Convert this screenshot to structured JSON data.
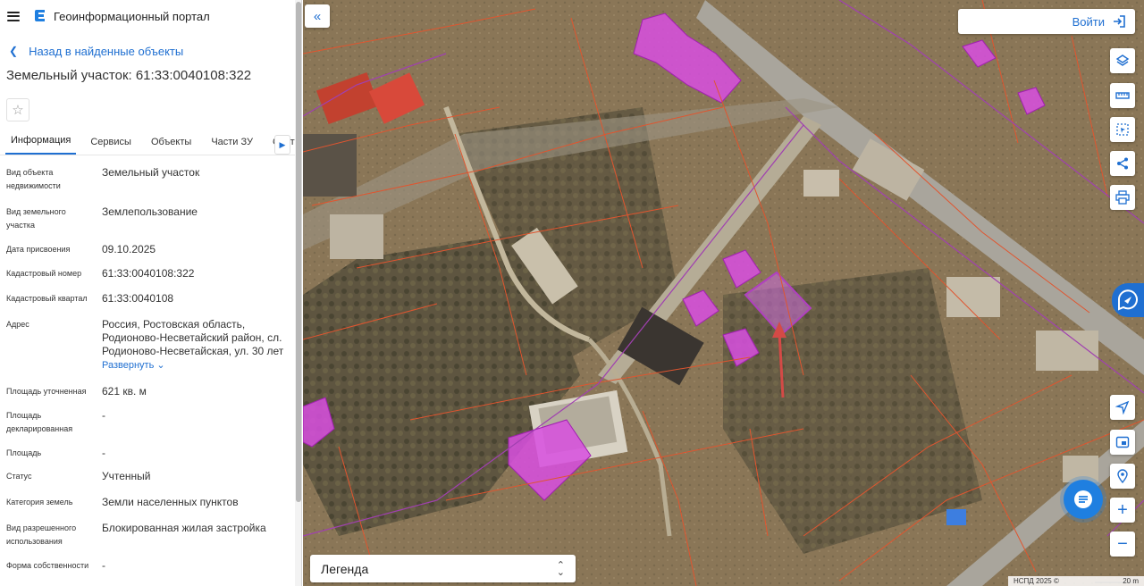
{
  "header": {
    "app_title": "Геоинформационный портал"
  },
  "back_link": "Назад в найденные объекты",
  "object_title": "Земельный участок: 61:33:0040108:322",
  "tabs": [
    {
      "label": "Информация"
    },
    {
      "label": "Сервисы"
    },
    {
      "label": "Объекты"
    },
    {
      "label": "Части ЗУ"
    },
    {
      "label": "Соста"
    }
  ],
  "properties": [
    {
      "key": "Вид объекта недвижимости",
      "value": "Земельный участок"
    },
    {
      "key": "Вид земельного участка",
      "value": "Землепользование"
    },
    {
      "key": "Дата присвоения",
      "value": "09.10.2025"
    },
    {
      "key": "Кадастровый номер",
      "value": "61:33:0040108:322"
    },
    {
      "key": "Кадастровый квартал",
      "value": "61:33:0040108"
    },
    {
      "key": "Адрес",
      "value": "Россия, Ростовская область, Родионово-Несветайский район, сл. Родионово-Несветайская, ул. 30 лет",
      "expand_label": "Развернуть"
    },
    {
      "key": "Площадь уточненная",
      "value": "621 кв. м"
    },
    {
      "key": "Площадь декларированная",
      "value": "-"
    },
    {
      "key": "Площадь",
      "value": "-"
    },
    {
      "key": "Статус",
      "value": "Учтенный"
    },
    {
      "key": "Категория земель",
      "value": "Земли населенных пунктов"
    },
    {
      "key": "Вид разрешенного использования",
      "value": "Блокированная жилая застройка"
    },
    {
      "key": "Форма собственности",
      "value": "-"
    }
  ],
  "map": {
    "login_label": "Войти",
    "legend_label": "Легенда",
    "attribution": "НСПД 2025 ©",
    "scale_label": "20 m",
    "icons": [
      "collapse-icon",
      "layers-icon",
      "ruler-icon",
      "select-area-icon",
      "share-icon",
      "print-icon",
      "locate-icon",
      "minimap-icon",
      "geolocation-icon",
      "zoom-in-icon",
      "zoom-out-icon",
      "chat-icon"
    ]
  }
}
